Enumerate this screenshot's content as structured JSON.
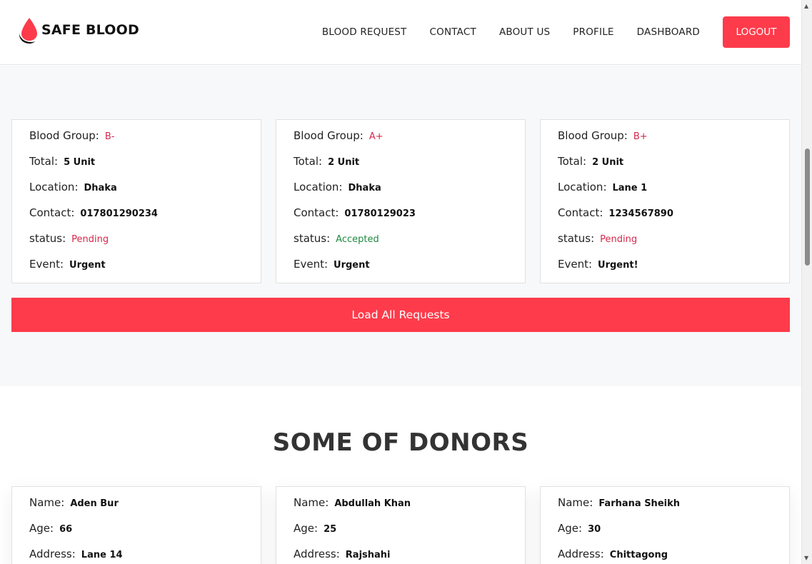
{
  "brand": {
    "name": "SAFE BLOOD",
    "icon": "blood-drop-icon"
  },
  "nav": {
    "links": [
      "BLOOD REQUEST",
      "CONTACT",
      "ABOUT US",
      "PROFILE",
      "DASHBOARD"
    ],
    "logout": "LOGOUT"
  },
  "labels": {
    "blood_group": "Blood Group:",
    "total": "Total:",
    "location": "Location:",
    "contact": "Contact:",
    "status": "status:",
    "event": "Event:",
    "name": "Name:",
    "age": "Age:",
    "address": "Address:"
  },
  "requests": [
    {
      "blood_group": "B-",
      "total": "5 Unit",
      "location": "Dhaka",
      "contact": "017801290234",
      "status": "Pending",
      "event": "Urgent"
    },
    {
      "blood_group": "A+",
      "total": "2 Unit",
      "location": "Dhaka",
      "contact": "01780129023",
      "status": "Accepted",
      "event": "Urgent"
    },
    {
      "blood_group": "B+",
      "total": "2 Unit",
      "location": "Lane 1",
      "contact": "1234567890",
      "status": "Pending",
      "event": "Urgent!"
    }
  ],
  "load_button": "Load All Requests",
  "donors_title": "SOME OF DONORS",
  "donors": [
    {
      "name": "Aden Bur",
      "age": "66",
      "address": "Lane 14"
    },
    {
      "name": "Abdullah Khan",
      "age": "25",
      "address": "Rajshahi"
    },
    {
      "name": "Farhana Sheikh",
      "age": "30",
      "address": "Chittagong"
    }
  ],
  "colors": {
    "accent": "#fe3b4b",
    "status_pending": "#d4284a",
    "status_accepted": "#1e8a3e"
  }
}
